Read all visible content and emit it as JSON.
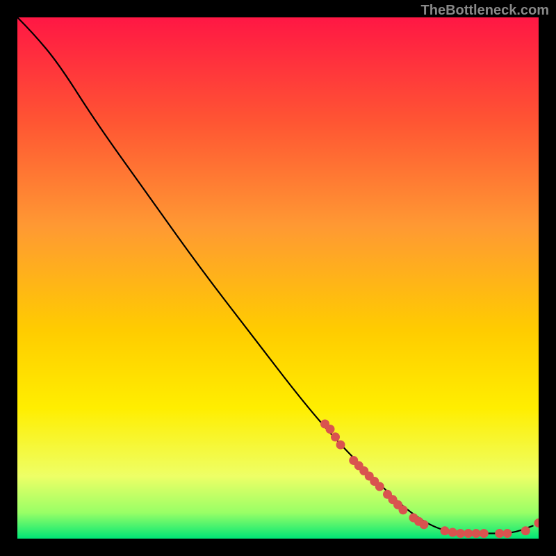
{
  "watermark": "TheBottleneck.com",
  "chart_data": {
    "type": "line",
    "title": "",
    "xlabel": "",
    "ylabel": "",
    "xlim": [
      0,
      100
    ],
    "ylim": [
      0,
      100
    ],
    "gradient_stops": [
      {
        "offset": 0,
        "color": "#ff1744"
      },
      {
        "offset": 20,
        "color": "#ff5533"
      },
      {
        "offset": 40,
        "color": "#ff9933"
      },
      {
        "offset": 60,
        "color": "#ffcc00"
      },
      {
        "offset": 75,
        "color": "#ffee00"
      },
      {
        "offset": 88,
        "color": "#eeff66"
      },
      {
        "offset": 95,
        "color": "#99ff66"
      },
      {
        "offset": 100,
        "color": "#00e676"
      }
    ],
    "curve": [
      {
        "x": 0,
        "y": 100
      },
      {
        "x": 3,
        "y": 97
      },
      {
        "x": 8,
        "y": 91
      },
      {
        "x": 15,
        "y": 80
      },
      {
        "x": 25,
        "y": 66
      },
      {
        "x": 35,
        "y": 52
      },
      {
        "x": 45,
        "y": 39
      },
      {
        "x": 55,
        "y": 26
      },
      {
        "x": 62,
        "y": 18
      },
      {
        "x": 68,
        "y": 12
      },
      {
        "x": 74,
        "y": 6
      },
      {
        "x": 80,
        "y": 2
      },
      {
        "x": 85,
        "y": 1
      },
      {
        "x": 90,
        "y": 1
      },
      {
        "x": 95,
        "y": 1
      },
      {
        "x": 99,
        "y": 2.5
      }
    ],
    "markers_color": "#d9534f",
    "markers": [
      {
        "x": 59,
        "y": 22
      },
      {
        "x": 60,
        "y": 21
      },
      {
        "x": 61,
        "y": 19.5
      },
      {
        "x": 62,
        "y": 18
      },
      {
        "x": 64.5,
        "y": 15
      },
      {
        "x": 65.5,
        "y": 14
      },
      {
        "x": 66.5,
        "y": 13
      },
      {
        "x": 67.5,
        "y": 12
      },
      {
        "x": 68.5,
        "y": 11
      },
      {
        "x": 69.5,
        "y": 10
      },
      {
        "x": 71,
        "y": 8.5
      },
      {
        "x": 72,
        "y": 7.5
      },
      {
        "x": 73,
        "y": 6.5
      },
      {
        "x": 74,
        "y": 5.5
      },
      {
        "x": 76,
        "y": 4
      },
      {
        "x": 77,
        "y": 3.3
      },
      {
        "x": 78,
        "y": 2.7
      },
      {
        "x": 82,
        "y": 1.5
      },
      {
        "x": 83.5,
        "y": 1.2
      },
      {
        "x": 85,
        "y": 1
      },
      {
        "x": 86.5,
        "y": 1
      },
      {
        "x": 88,
        "y": 1
      },
      {
        "x": 89.5,
        "y": 1
      },
      {
        "x": 92.5,
        "y": 1
      },
      {
        "x": 94,
        "y": 1
      },
      {
        "x": 97.5,
        "y": 1.5
      },
      {
        "x": 100,
        "y": 3
      }
    ]
  }
}
